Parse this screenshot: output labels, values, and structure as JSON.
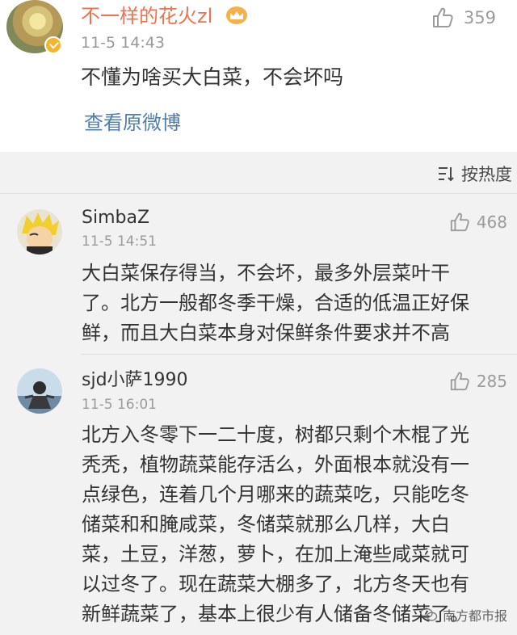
{
  "post": {
    "username": "不一样的花火zl",
    "time": "11-5 14:43",
    "text": "不懂为啥买大白菜，不会坏吗",
    "view_original": "查看原微博",
    "likes": "359"
  },
  "sort": {
    "label": "按热度"
  },
  "comments": [
    {
      "username": "SimbaZ",
      "time": "11-5 14:51",
      "likes": "468",
      "lines": [
        "大白菜保存得当，不会坏，最多外层菜叶干",
        "了。北方一般都冬季干燥，合适的低温正好保",
        "鲜，而且大白菜本身对保鲜条件要求并不高"
      ]
    },
    {
      "username": "sjd小萨1990",
      "time": "11-5 16:01",
      "likes": "285",
      "lines": [
        "北方入冬零下一二十度，树都只剩个木棍了光",
        "秃秃，植物蔬菜能存活么，外面根本就没有一",
        "点绿色，连着几个月哪来的蔬菜吃，只能吃冬",
        "储菜和和腌咸菜，冬储菜就那么几样，大白",
        "菜，土豆，洋葱，萝卜，在加上淹些咸菜就可",
        "以过冬了。现在蔬菜大棚多了，北方冬天也有",
        "新鲜蔬菜了，基本上很少有人储备冬储菜了。"
      ]
    }
  ],
  "watermark": {
    "text": "南方都市报"
  },
  "icons": {
    "like": "thumbs-up-icon",
    "sort": "sort-icon",
    "vip": "verified-badge-icon",
    "crown": "crown-icon",
    "wechat": "wechat-icon"
  },
  "colors": {
    "username_vip": "#eb7350",
    "link": "#507daf",
    "muted": "#9b9b9b",
    "background": "#f2f2f2"
  }
}
